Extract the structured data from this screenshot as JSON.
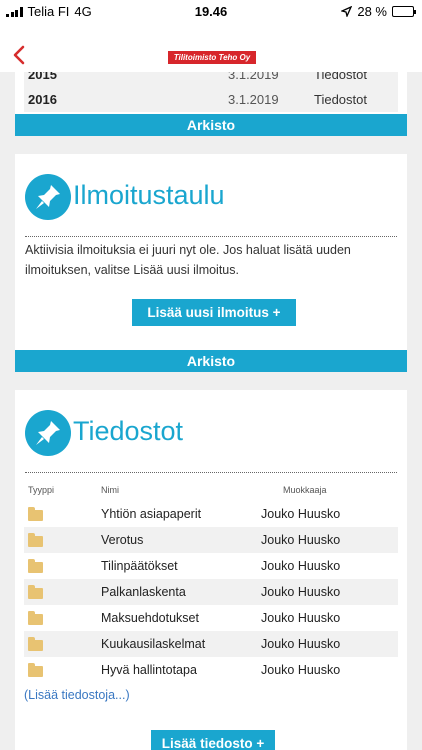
{
  "status_bar": {
    "carrier": "Telia FI",
    "network": "4G",
    "time": "19.46",
    "battery": "28 %",
    "battery_level": 0.28
  },
  "header": {
    "logo_text": "Tilitoimisto Teho Oy"
  },
  "prev_table": {
    "rows": [
      {
        "year": "2016",
        "date": "3.1.2019",
        "type": "Tiedostot"
      }
    ],
    "archive_label": "Arkisto"
  },
  "bulletin": {
    "title": "Ilmoitustaulu",
    "message": "Aktiivisia ilmoituksia ei juuri nyt ole. Jos haluat lisätä uuden ilmoituksen, valitse Lisää uusi ilmoitus.",
    "add_button": "Lisää uusi ilmoitus +",
    "archive_label": "Arkisto"
  },
  "files": {
    "title": "Tiedostot",
    "headers": {
      "type": "Tyyppi",
      "name": "Nimi",
      "modifier": "Muokkaaja"
    },
    "rows": [
      {
        "name": "Yhtiön asiapaperit",
        "modifier": "Jouko Huusko"
      },
      {
        "name": "Verotus",
        "modifier": "Jouko Huusko"
      },
      {
        "name": "Tilinpäätökset",
        "modifier": "Jouko Huusko"
      },
      {
        "name": "Palkanlaskenta",
        "modifier": "Jouko Huusko"
      },
      {
        "name": "Maksuehdotukset",
        "modifier": "Jouko Huusko"
      },
      {
        "name": "Kuukausilaskelmat",
        "modifier": "Jouko Huusko"
      },
      {
        "name": "Hyvä hallintotapa",
        "modifier": "Jouko Huusko"
      }
    ],
    "more_link": "(Lisää tiedostoja...)",
    "add_button": "Lisää tiedosto +"
  },
  "colors": {
    "accent": "#1aa6cf",
    "logo_red": "#d7262b",
    "back_arrow": "#d62d2d",
    "link": "#3a78c2"
  },
  "icons": {
    "back": "chevron-left-icon",
    "pin": "pushpin-icon",
    "folder": "folder-icon",
    "location": "location-arrow-icon"
  }
}
